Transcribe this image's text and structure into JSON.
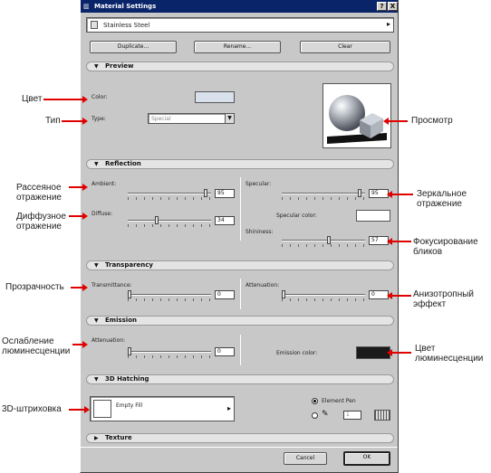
{
  "window": {
    "title": "Material Settings",
    "help_label": "?",
    "close_label": "X"
  },
  "material": {
    "selected": "Stainless Steel"
  },
  "buttons": {
    "duplicate": "Duplicate...",
    "rename": "Rename...",
    "clear": "Clear",
    "cancel": "Cancel",
    "ok": "OK"
  },
  "preview": {
    "section": "Preview",
    "color_label": "Color:",
    "type_label": "Type:",
    "type_value": "Special"
  },
  "reflection": {
    "section": "Reflection",
    "ambient_label": "Ambient:",
    "ambient_value": "95",
    "diffuse_label": "Diffuse:",
    "diffuse_value": "34",
    "specular_label": "Specular:",
    "specular_value": "95",
    "specular_color_label": "Specular color:",
    "shininess_label": "Shininess:",
    "shininess_value": "57"
  },
  "transparency": {
    "section": "Transparency",
    "transmittance_label": "Transmittance:",
    "transmittance_value": "0",
    "attenuation_label": "Attenuation:",
    "attenuation_value": "0"
  },
  "emission": {
    "section": "Emission",
    "attenuation_label": "Attenuation:",
    "attenuation_value": "0",
    "color_label": "Emission color:"
  },
  "hatching": {
    "section": "3D Hatching",
    "fill_name": "Empty Fill",
    "element_pen_label": "Element Pen",
    "pen_number": "1"
  },
  "texture": {
    "section": "Texture"
  },
  "annotations": {
    "color": "Цвет",
    "type": "Тип",
    "preview": "Просмотр",
    "ambient_line1": "Рассеяное",
    "ambient_line2": "отражение",
    "diffuse_line1": "Диффузное",
    "diffuse_line2": "отражение",
    "specular_line1": "Зеркальное",
    "specular_line2": "отражение",
    "shininess_line1": "Фокусирование",
    "shininess_line2": "бликов",
    "transparency": "Прозрачность",
    "anisotropy_line1": "Анизотропный",
    "anisotropy_line2": "эффект",
    "emission_att_line1": "Ослабление",
    "emission_att_line2": "люминесценции",
    "emission_color_line1": "Цвет",
    "emission_color_line2": "люминесценции",
    "hatching": "3D-штриховка"
  },
  "colors": {
    "accent_arrow": "#e00000",
    "titlebar": "#0a246a",
    "emission_swatch": "#1a1a1a",
    "color_swatch": "#d8e0ec"
  },
  "slider_levels": {
    "ambient": 0.95,
    "diffuse": 0.34,
    "specular": 0.95,
    "shininess": 0.57,
    "transmittance": 0.0,
    "attenuation": 0.0,
    "emission_attenuation": 0.0
  }
}
